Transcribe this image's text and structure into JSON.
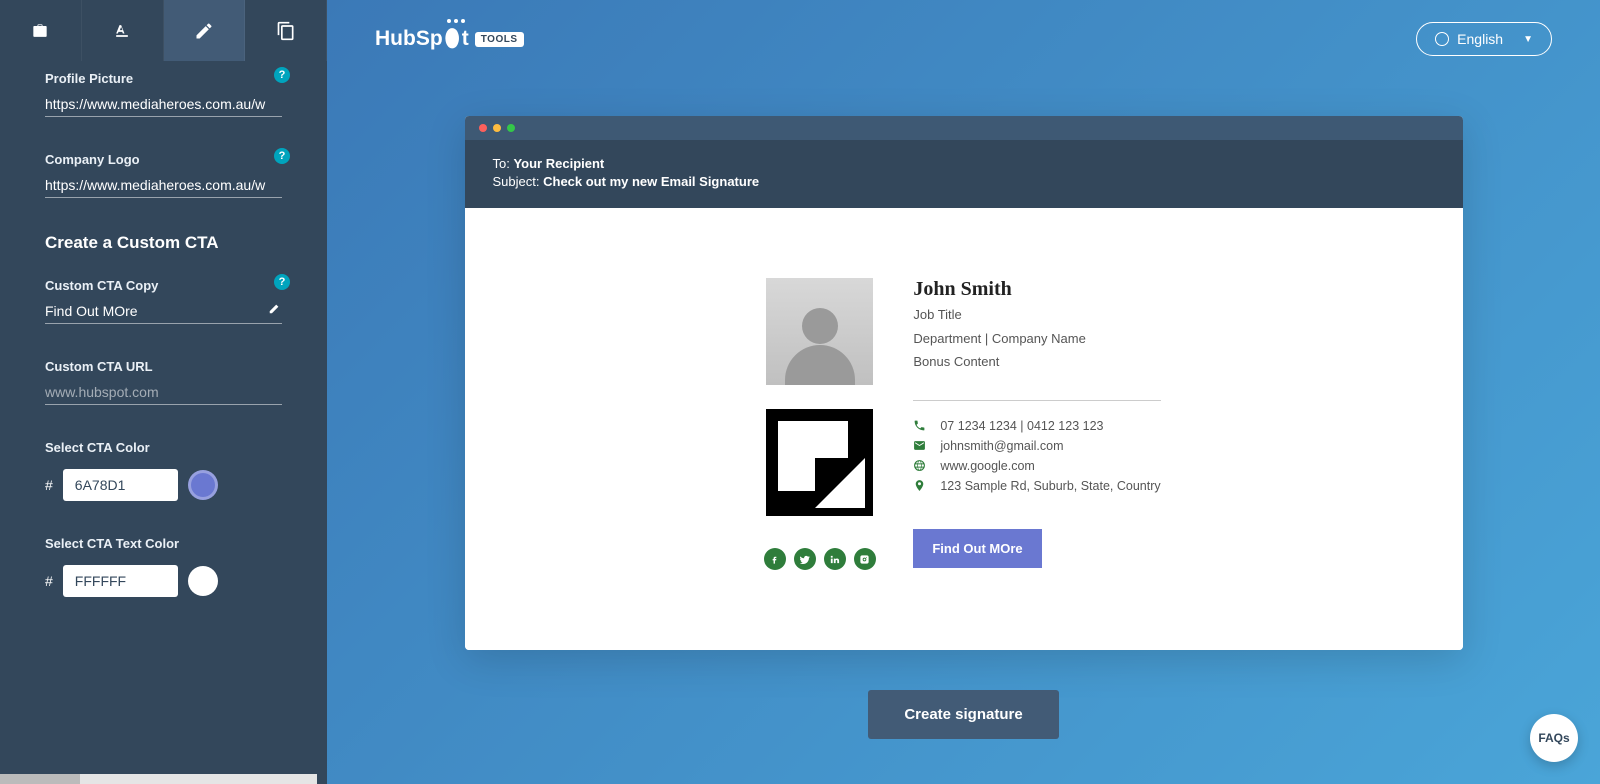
{
  "brand": {
    "name": "HubSpot",
    "badge": "TOOLS"
  },
  "language": "English",
  "sidebar": {
    "profile_picture": {
      "label": "Profile Picture",
      "value": "https://www.mediaheroes.com.au/w"
    },
    "company_logo": {
      "label": "Company Logo",
      "value": "https://www.mediaheroes.com.au/w"
    },
    "cta_heading": "Create a Custom CTA",
    "cta_copy": {
      "label": "Custom CTA Copy",
      "value": "Find Out MOre"
    },
    "cta_url": {
      "label": "Custom CTA URL",
      "placeholder": "www.hubspot.com",
      "value": ""
    },
    "cta_color": {
      "label": "Select CTA Color",
      "value": "6A78D1"
    },
    "cta_text_color": {
      "label": "Select CTA Text Color",
      "value": "FFFFFF"
    }
  },
  "mail": {
    "to_label": "To:",
    "to_value": "Your Recipient",
    "subject_label": "Subject:",
    "subject_value": "Check out my new Email Signature"
  },
  "signature": {
    "name": "John Smith",
    "job_title": "Job Title",
    "dept_company": "Department | Company Name",
    "bonus": "Bonus Content",
    "phone": "07 1234 1234 | 0412 123 123",
    "email": "johnsmith@gmail.com",
    "website": "www.google.com",
    "address": "123 Sample Rd, Suburb, State, Country",
    "cta_label": "Find Out MOre"
  },
  "create_button": "Create signature",
  "faqs": "FAQs",
  "colors": {
    "cta_bg": "#6a78d1",
    "cta_text": "#ffffff"
  }
}
